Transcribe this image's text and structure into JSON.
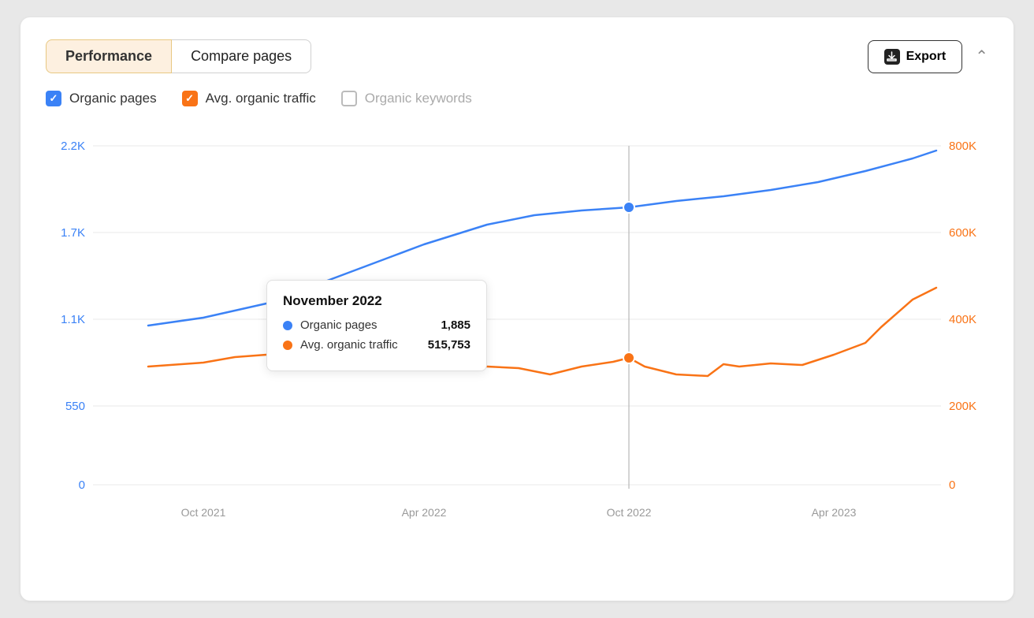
{
  "tabs": [
    {
      "label": "Performance",
      "active": true
    },
    {
      "label": "Compare pages",
      "active": false
    }
  ],
  "export_button": {
    "label": "Export"
  },
  "legend": [
    {
      "label": "Organic pages",
      "checked": true,
      "color": "blue"
    },
    {
      "label": "Avg. organic traffic",
      "checked": true,
      "color": "orange"
    },
    {
      "label": "Organic keywords",
      "checked": false,
      "color": "none"
    }
  ],
  "chart": {
    "y_axis_left": [
      "2.2K",
      "1.7K",
      "1.1K",
      "550",
      "0"
    ],
    "y_axis_right": [
      "800K",
      "600K",
      "400K",
      "200K",
      "0"
    ],
    "x_axis": [
      "Oct 2021",
      "Apr 2022",
      "Oct 2022",
      "Apr 2023"
    ],
    "tooltip": {
      "title": "November 2022",
      "rows": [
        {
          "label": "Organic pages",
          "value": "1,885",
          "color": "#3b82f6"
        },
        {
          "label": "Avg. organic traffic",
          "value": "515,753",
          "color": "#f97316"
        }
      ]
    }
  },
  "accent_blue": "#3b82f6",
  "accent_orange": "#f97316"
}
